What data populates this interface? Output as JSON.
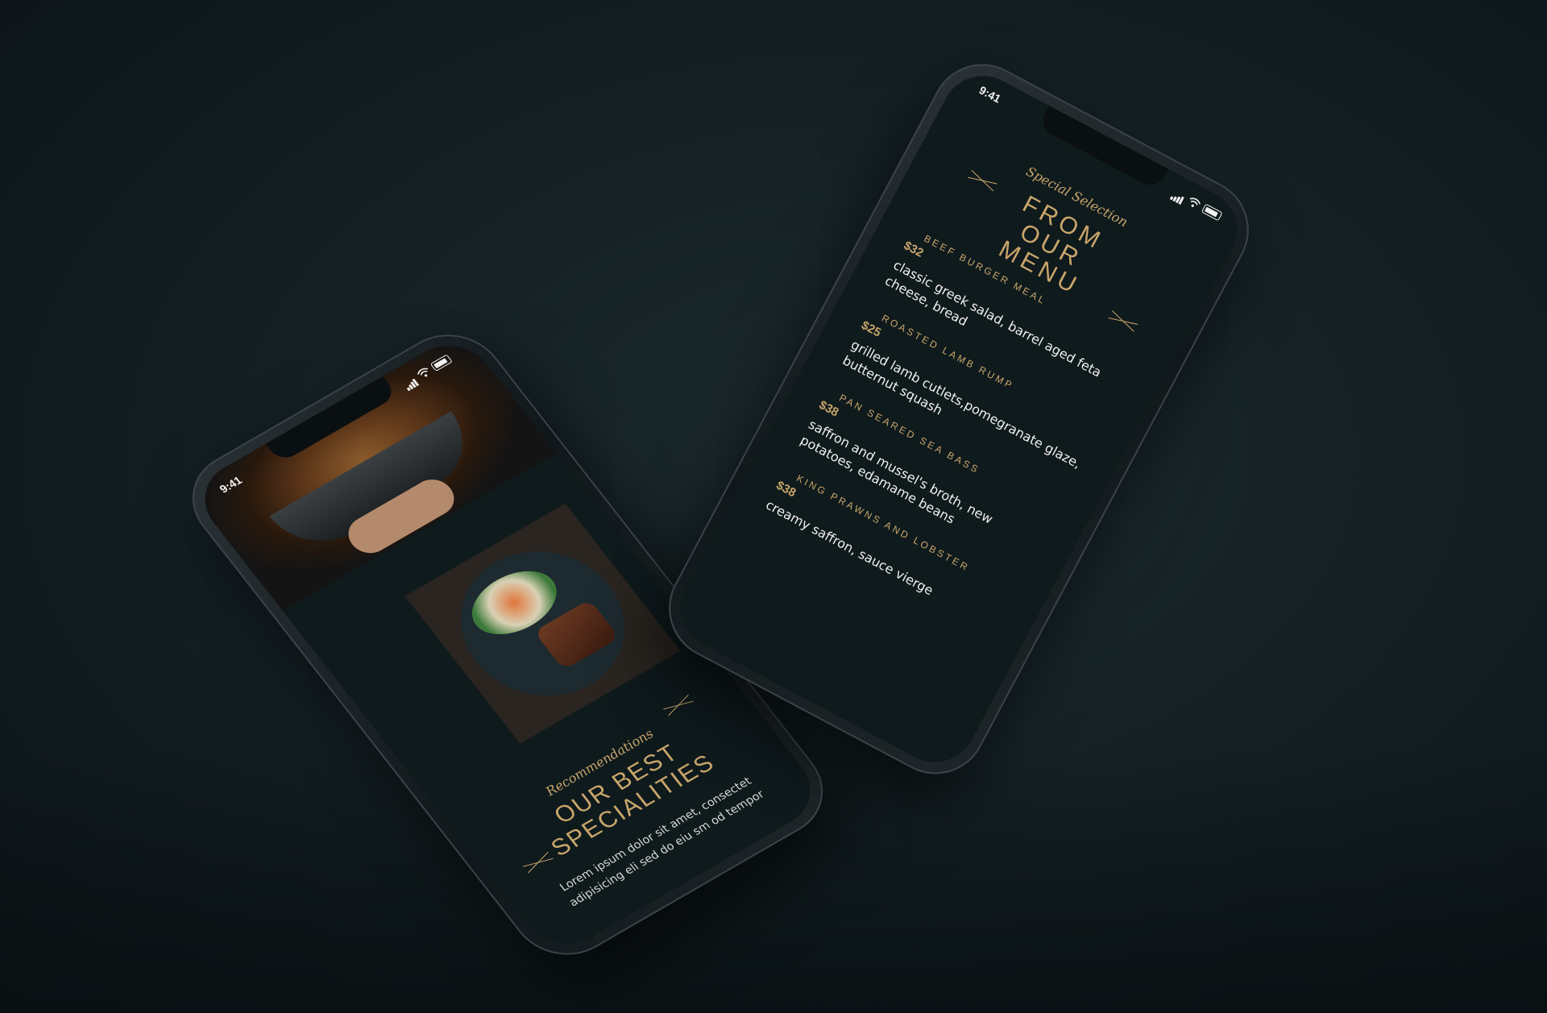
{
  "colors": {
    "background": "#142024",
    "screen": "#0f1a1d",
    "gold": "#c9a66b",
    "text": "#f0f0f0"
  },
  "status_bar": {
    "time": "9:41",
    "icons": [
      "signal-icon",
      "wifi-icon",
      "battery-icon"
    ]
  },
  "back_phone": {
    "recommendations": {
      "kicker": "Recommendations",
      "title_line_1": "OUR BEST",
      "title_line_2": "SPECIALITIES",
      "body": "Lorem ipsum dolor sit amet, consectet adipisicing eli sed do eiu sm od tempor"
    }
  },
  "front_phone": {
    "menu": {
      "kicker": "Special Selection",
      "title_line_1": "FROM",
      "title_line_2": "OUR",
      "title_line_3": "MENU",
      "items": [
        {
          "name": "BEEF BURGER MEAL",
          "price": "$32",
          "description": "classic greek salad, barrel aged feta cheese, bread"
        },
        {
          "name": "ROASTED LAMB RUMP",
          "price": "$25",
          "description": "grilled lamb cutlets,pomegranate glaze, butternut squash"
        },
        {
          "name": "PAN SEARED SEA BASS",
          "price": "$38",
          "description": "saffron and mussel's broth, new potatoes, edamame beans"
        },
        {
          "name": "KING PRAWNS AND LOBSTER",
          "price": "$38",
          "description": "creamy saffron, sauce vierge"
        }
      ]
    }
  }
}
